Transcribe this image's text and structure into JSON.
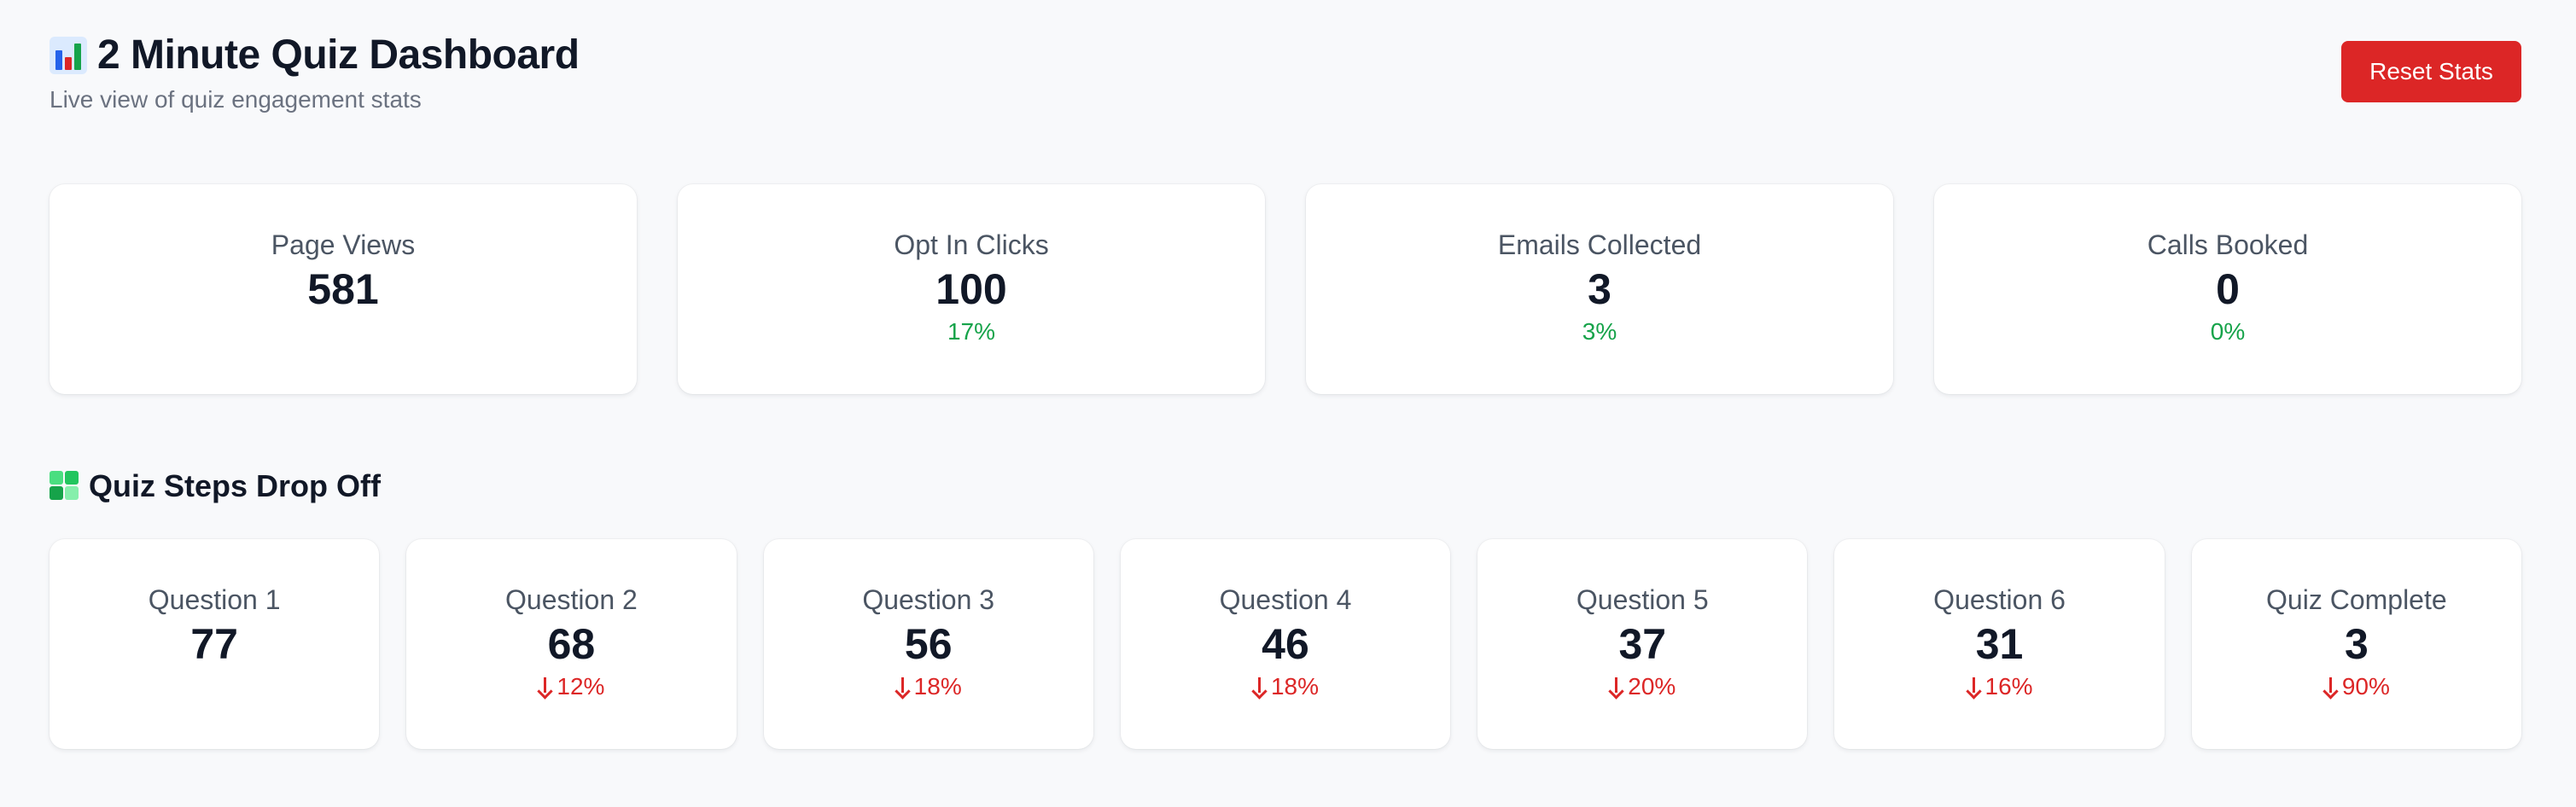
{
  "header": {
    "title": "2 Minute Quiz Dashboard",
    "subtitle": "Live view of quiz engagement stats",
    "icon": "bar-chart-icon",
    "reset_label": "Reset Stats"
  },
  "summary": [
    {
      "label": "Page Views",
      "value": "581",
      "rate": ""
    },
    {
      "label": "Opt In Clicks",
      "value": "100",
      "rate": "17%"
    },
    {
      "label": "Emails Collected",
      "value": "3",
      "rate": "3%"
    },
    {
      "label": "Calls Booked",
      "value": "0",
      "rate": "0%"
    }
  ],
  "steps_section": {
    "title": "Quiz Steps Drop Off",
    "icon": "puzzle-icon"
  },
  "steps": [
    {
      "label": "Question 1",
      "value": "77",
      "drop": ""
    },
    {
      "label": "Question 2",
      "value": "68",
      "drop": "12%"
    },
    {
      "label": "Question 3",
      "value": "56",
      "drop": "18%"
    },
    {
      "label": "Question 4",
      "value": "46",
      "drop": "18%"
    },
    {
      "label": "Question 5",
      "value": "37",
      "drop": "20%"
    },
    {
      "label": "Question 6",
      "value": "31",
      "drop": "16%"
    },
    {
      "label": "Quiz Complete",
      "value": "3",
      "drop": "90%"
    }
  ],
  "colors": {
    "background": "#f8f9fb",
    "positive": "#16a34a",
    "negative": "#dc2626",
    "button": "#dc2626"
  }
}
